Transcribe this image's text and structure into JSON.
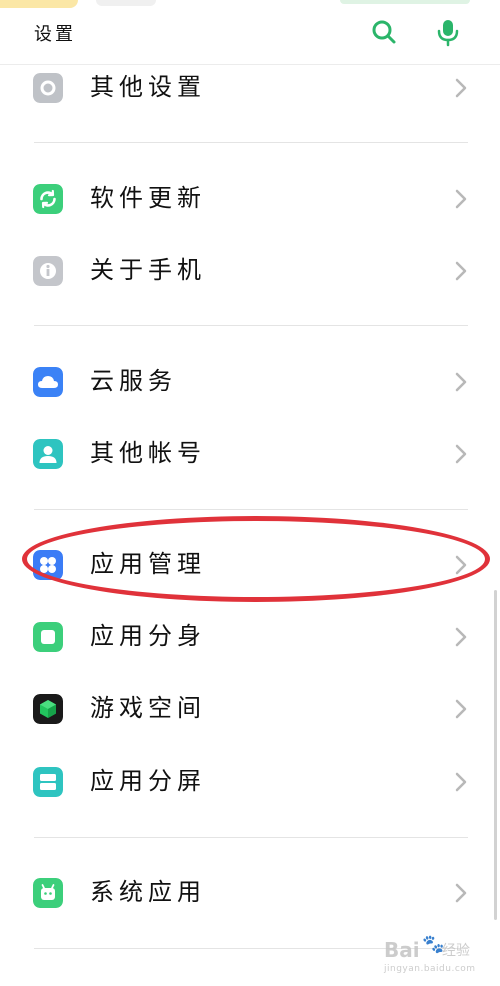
{
  "header": {
    "title": "设置"
  },
  "sections": [
    {
      "items": [
        {
          "label": "其他设置",
          "icon": "other-settings-icon",
          "color": "#bfc2c7"
        }
      ]
    },
    {
      "items": [
        {
          "label": "软件更新",
          "icon": "software-update-icon",
          "color": "#3ccf7b"
        },
        {
          "label": "关于手机",
          "icon": "about-phone-icon",
          "color": "#c4c6cb"
        }
      ]
    },
    {
      "items": [
        {
          "label": "云服务",
          "icon": "cloud-icon",
          "color": "#3b82f6"
        },
        {
          "label": "其他帐号",
          "icon": "account-icon",
          "color": "#2ec4c0"
        }
      ]
    },
    {
      "items": [
        {
          "label": "应用管理",
          "icon": "app-management-icon",
          "color": "#3b7cf6"
        },
        {
          "label": "应用分身",
          "icon": "app-clone-icon",
          "color": "#3ccf7b"
        },
        {
          "label": "游戏空间",
          "icon": "game-space-icon",
          "color": "#1a1a1a"
        },
        {
          "label": "应用分屏",
          "icon": "split-screen-icon",
          "color": "#2ec4c0"
        }
      ]
    },
    {
      "items": [
        {
          "label": "系统应用",
          "icon": "system-apps-icon",
          "color": "#3ccf7b"
        }
      ]
    }
  ],
  "colors": {
    "accent": "#2bb56a",
    "annotation": "#e0323a"
  },
  "watermark": {
    "brand": "Bai",
    "suffix": "经验",
    "url": "jingyan.baidu.com"
  }
}
